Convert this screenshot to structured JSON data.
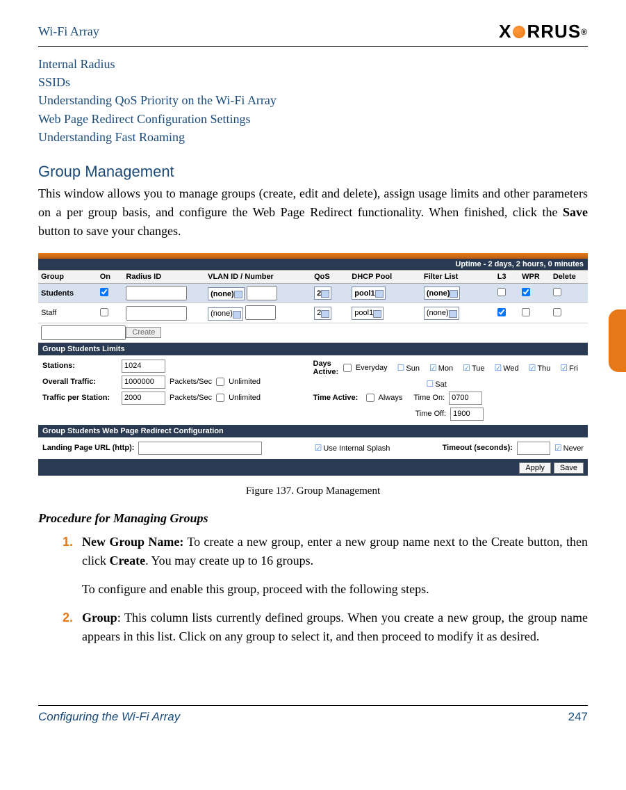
{
  "header": {
    "title": "Wi-Fi Array",
    "logo_prefix": "X",
    "logo_suffix": "RRUS"
  },
  "links": [
    "Internal Radius",
    "SSIDs",
    "Understanding QoS Priority on the Wi-Fi Array",
    "Web Page Redirect Configuration Settings",
    "Understanding Fast Roaming"
  ],
  "section": {
    "heading": "Group Management",
    "para_before_bold": "This window allows you to manage groups (create, edit and delete), assign usage limits and other parameters on a per group basis, and configure the Web Page Redirect functionality. When finished, click the ",
    "bold": "Save",
    "para_after_bold": " button to save your changes."
  },
  "screenshot": {
    "uptime": "Uptime - 2 days, 2 hours, 0 minutes",
    "cols": {
      "group": "Group",
      "on": "On",
      "radius": "Radius ID",
      "vlan": "VLAN ID / Number",
      "qos": "QoS",
      "dhcp": "DHCP Pool",
      "filter": "Filter List",
      "l3": "L3",
      "wpr": "WPR",
      "del": "Delete"
    },
    "rows": [
      {
        "group": "Students",
        "on": true,
        "radius": "",
        "vlan": "(none)",
        "qos": "2",
        "dhcp": "pool1",
        "filter": "(none)",
        "l3": false,
        "wpr": true,
        "del": false
      },
      {
        "group": "Staff",
        "on": false,
        "radius": "",
        "vlan": "(none)",
        "qos": "2",
        "dhcp": "pool1",
        "filter": "(none)",
        "l3": true,
        "wpr": false,
        "del": false
      }
    ],
    "create_btn": "Create",
    "limits_bar": "Group  Students  Limits",
    "limits": {
      "stations_label": "Stations:",
      "stations_val": "1024",
      "overall_label": "Overall Traffic:",
      "overall_val": "1000000",
      "unit": "Packets/Sec",
      "unlimited": "Unlimited",
      "perstation_label": "Traffic per Station:",
      "perstation_val": "2000",
      "days_label": "Days Active:",
      "everyday": "Everyday",
      "days": {
        "sun": "Sun",
        "mon": "Mon",
        "tue": "Tue",
        "wed": "Wed",
        "thu": "Thu",
        "fri": "Fri",
        "sat": "Sat"
      },
      "time_label": "Time Active:",
      "always": "Always",
      "time_on_label": "Time On:",
      "time_on": "0700",
      "time_off_label": "Time Off:",
      "time_off": "1900"
    },
    "wpr_bar": "Group  Students  Web Page Redirect Configuration",
    "wpr": {
      "landing_label": "Landing Page URL (http):",
      "internal_splash": "Use Internal Splash",
      "timeout_label": "Timeout (seconds):",
      "never": "Never"
    },
    "apply": "Apply",
    "save": "Save"
  },
  "figure_caption": "Figure 137. Group Management",
  "procedure": {
    "heading": "Procedure for Managing Groups",
    "items": [
      {
        "bold": "New Group Name:",
        "rest": " To create a new group, enter a new group name next to the Create button, then click ",
        "bold2": "Create",
        "rest2": ". You may create up to 16 groups.",
        "para2": "To configure and enable this group, proceed with the following steps."
      },
      {
        "bold": "Group",
        "rest": ": This column lists currently defined groups. When you create a new group, the group name appears in this list. Click on any group to select it, and then proceed to modify it as desired."
      }
    ]
  },
  "footer": {
    "left": "Configuring the Wi-Fi Array",
    "right": "247"
  }
}
